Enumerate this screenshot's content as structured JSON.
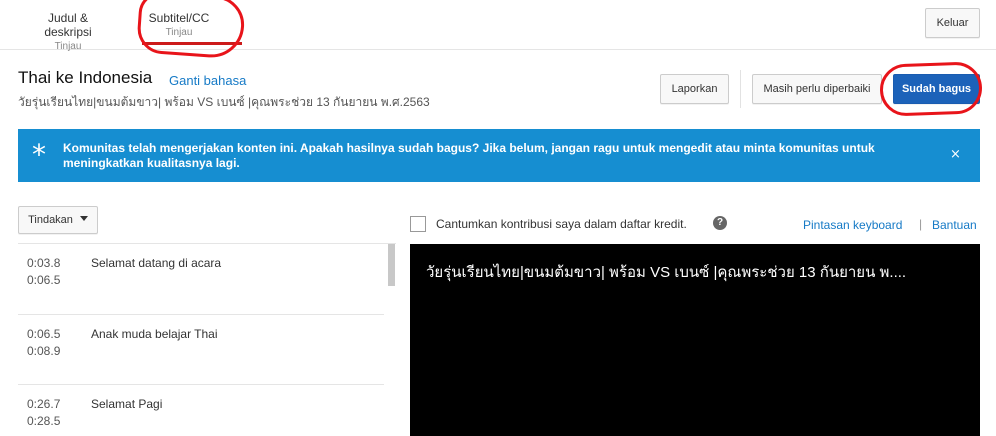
{
  "tabs": [
    {
      "label": "Judul & deskripsi",
      "sub": "Tinjau"
    },
    {
      "label": "Subtitel/CC",
      "sub": "Tinjau"
    }
  ],
  "header": {
    "logout_label": "Keluar",
    "title": "Thai ke Indonesia",
    "change_language": "Ganti bahasa",
    "video_title": "วัยรุ่นเรียนไทย|ขนมต้มขาว| พร้อม VS เบนซ์ |คุณพระช่วย 13 กันยายน พ.ศ.2563",
    "report_label": "Laporkan",
    "needs_work_label": "Masih perlu diperbaiki",
    "looks_good_label": "Sudah bagus"
  },
  "banner": {
    "icon": "asterisk-icon",
    "message": "Komunitas telah mengerjakan konten ini. Apakah hasilnya sudah bagus? Jika belum, jangan ragu untuk mengedit atau minta komunitas untuk meningkatkan kualitasnya lagi.",
    "close": "×"
  },
  "actions": {
    "label": "Tindakan"
  },
  "captions": [
    {
      "start": "0:03.8",
      "end": "0:06.5",
      "text": "Selamat datang di acara"
    },
    {
      "start": "0:06.5",
      "end": "0:08.9",
      "text": "Anak muda belajar Thai"
    },
    {
      "start": "0:26.7",
      "end": "0:28.5",
      "text": "Selamat Pagi"
    }
  ],
  "credit": {
    "label": "Cantumkan kontribusi saya dalam daftar kredit.",
    "help": "?"
  },
  "links": {
    "keyboard": "Pintasan keyboard",
    "separator": "|",
    "help": "Bantuan"
  },
  "player": {
    "caption": "วัยรุ่นเรียนไทย|ขนมต้มขาว| พร้อม VS เบนซ์ |คุณพระช่วย 13 กันยายน พ...."
  },
  "colors": {
    "accent_blue": "#1c62b9",
    "banner_blue": "#168ed1",
    "annotation_red": "#e8141a",
    "link_blue": "#167ac6"
  }
}
